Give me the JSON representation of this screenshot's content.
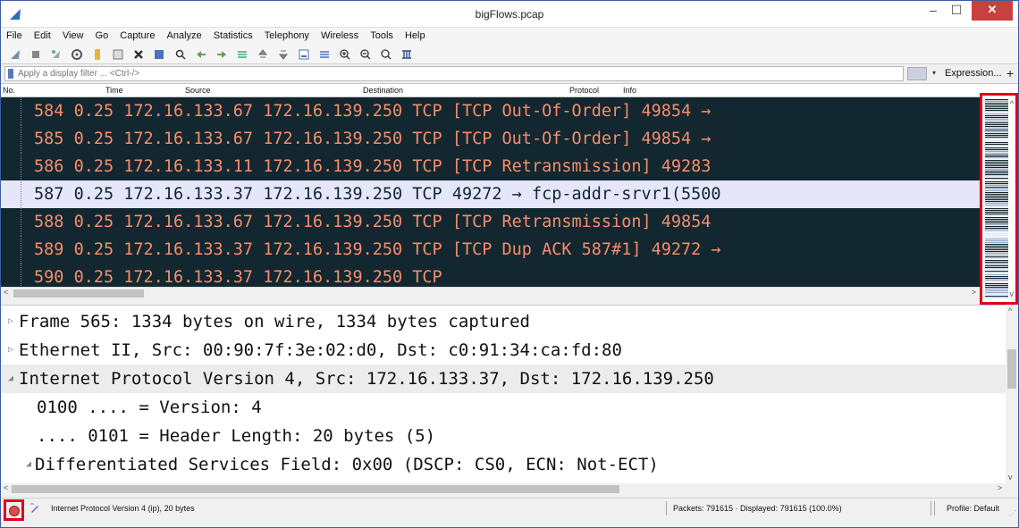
{
  "window": {
    "title": "bigFlows.pcap",
    "close_glyph": "✕",
    "min_glyph": "–",
    "max_glyph": "☐"
  },
  "menu": [
    "File",
    "Edit",
    "View",
    "Go",
    "Capture",
    "Analyze",
    "Statistics",
    "Telephony",
    "Wireless",
    "Tools",
    "Help"
  ],
  "filter": {
    "placeholder": "Apply a display filter ... <Ctrl-/>",
    "expression_label": "Expression...",
    "plus_label": "+",
    "dropdown_glyph": "▾"
  },
  "packet_list": {
    "columns": [
      "No.",
      "Time",
      "Source",
      "Destination",
      "Protocol",
      "Info"
    ],
    "rows": [
      {
        "no": "584",
        "time": "0.25",
        "source": "172.16.133.67",
        "destination": "172.16.139.250",
        "protocol": "TCP",
        "info": "[TCP Out-Of-Order] 49854 →",
        "selected": false
      },
      {
        "no": "585",
        "time": "0.25",
        "source": "172.16.133.67",
        "destination": "172.16.139.250",
        "protocol": "TCP",
        "info": "[TCP Out-Of-Order] 49854 →",
        "selected": false
      },
      {
        "no": "586",
        "time": "0.25",
        "source": "172.16.133.11",
        "destination": "172.16.139.250",
        "protocol": "TCP",
        "info": "[TCP Retransmission] 49283",
        "selected": false
      },
      {
        "no": "587",
        "time": "0.25",
        "source": "172.16.133.37",
        "destination": "172.16.139.250",
        "protocol": "TCP",
        "info": "49272 → fcp-addr-srvr1(5500",
        "selected": true
      },
      {
        "no": "588",
        "time": "0.25",
        "source": "172.16.133.67",
        "destination": "172.16.139.250",
        "protocol": "TCP",
        "info": "[TCP Retransmission] 49854",
        "selected": false
      },
      {
        "no": "589",
        "time": "0.25",
        "source": "172.16.133.37",
        "destination": "172.16.139.250",
        "protocol": "TCP",
        "info": "[TCP Dup ACK 587#1] 49272 →",
        "selected": false
      },
      {
        "no": "590",
        "time": "0.25",
        "source": "172.16.133.37",
        "destination": "172.16.139.250",
        "protocol": "TCP",
        "info": "",
        "selected": false
      }
    ]
  },
  "details": {
    "lines": [
      {
        "arrow": "▷",
        "text": "Frame 565: 1334 bytes on wire, 1334 bytes captured",
        "level": "top",
        "highlight": false
      },
      {
        "arrow": "▷",
        "text": "Ethernet II, Src: 00:90:7f:3e:02:d0, Dst: c0:91:34:ca:fd:80",
        "level": "top",
        "highlight": false
      },
      {
        "arrow": "◢",
        "text": "Internet Protocol Version 4, Src: 172.16.133.37, Dst: 172.16.139.250",
        "level": "top",
        "highlight": true
      },
      {
        "arrow": "",
        "text": "0100 .... = Version: 4",
        "level": "child",
        "highlight": false
      },
      {
        "arrow": "",
        "text": ".... 0101 = Header Length: 20 bytes (5)",
        "level": "child",
        "highlight": false
      },
      {
        "arrow": "◢",
        "text": "Differentiated Services Field: 0x00 (DSCP: CS0, ECN: Not-ECT)",
        "level": "sub",
        "highlight": false
      }
    ]
  },
  "status": {
    "left": "Internet Protocol Version 4 (ip), 20 bytes",
    "packets": "Packets: 791615 · Displayed: 791615 (100.0%)",
    "profile": "Profile: Default"
  },
  "colors": {
    "row_bg": "#12272f",
    "row_fg": "#f78c6c",
    "selected_bg": "#e6e6fa",
    "highlight_box": "#e0001b"
  }
}
